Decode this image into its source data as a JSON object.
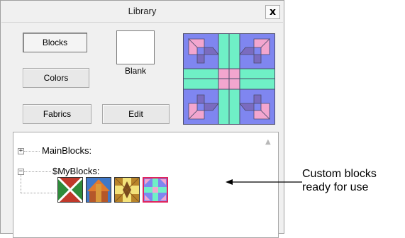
{
  "window": {
    "title": "Library",
    "close_label": "x"
  },
  "buttons": {
    "blocks": "Blocks",
    "colors": "Colors",
    "fabrics": "Fabrics",
    "edit": "Edit"
  },
  "blank": {
    "label": "Blank"
  },
  "tree": {
    "nodes": [
      {
        "label": "MainBlocks:",
        "expander": "+"
      },
      {
        "label": "$MyBlocks:",
        "expander": "−"
      }
    ],
    "thumbnails": [
      "quilt-block-1",
      "quilt-block-2",
      "quilt-block-3",
      "quilt-block-4"
    ]
  },
  "annotation": {
    "line1": "Custom blocks",
    "line2": "ready for use"
  },
  "colors": {
    "preview_blue": "#7f86f0",
    "preview_pink": "#f2a6cf",
    "preview_mint": "#6ff0c6",
    "preview_purple": "#7a6bbf"
  }
}
